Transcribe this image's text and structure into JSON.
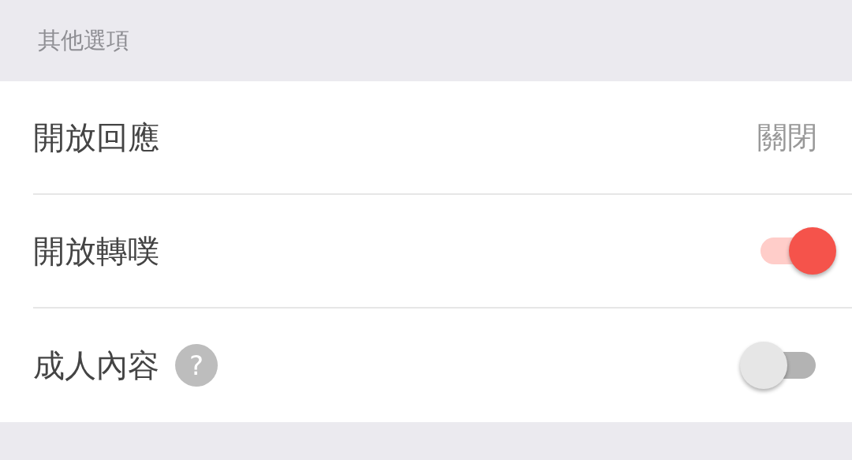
{
  "section": {
    "title": "其他選項"
  },
  "rows": [
    {
      "kind": "value",
      "label": "開放回應",
      "value": "關閉"
    },
    {
      "kind": "toggle",
      "label": "開放轉噗",
      "on": true
    },
    {
      "kind": "toggle",
      "label": "成人內容",
      "on": false,
      "help": "?"
    }
  ]
}
